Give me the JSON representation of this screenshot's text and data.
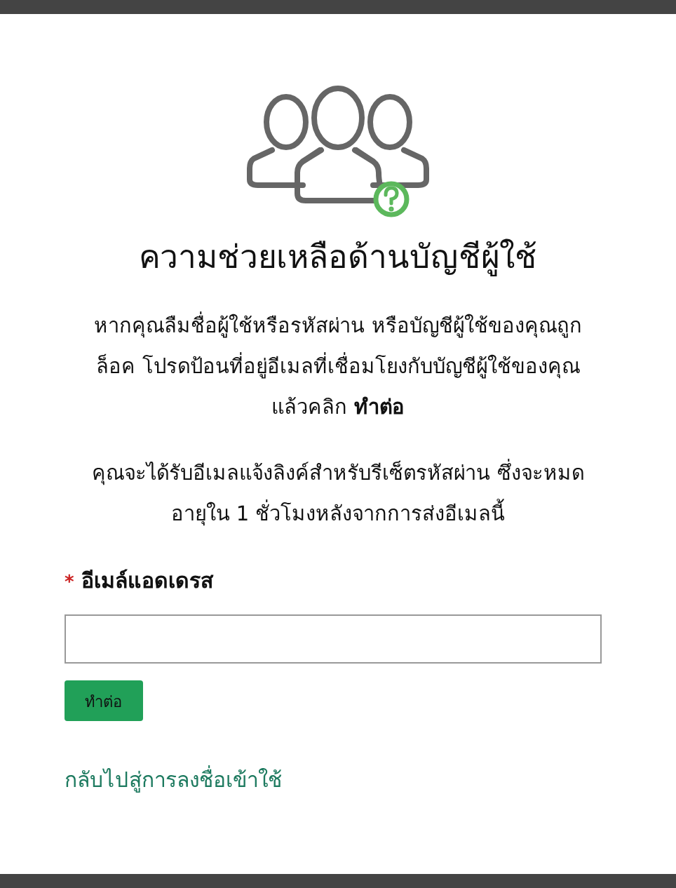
{
  "title": "ความช่วยเหลือด้านบัญชีผู้ใช้",
  "paragraphs": [
    "หากคุณลืมชื่อผู้ใช้หรือรหัสผ่าน หรือบัญชีผู้ใช้ของคุณถูกล็อค โปรดป้อนที่อยู่อีเมลที่เชื่อมโยงกับบัญชีผู้ใช้ของคุณ แล้วคลิก **ทำต่อ**",
    "คุณจะได้รับอีเมลแจ้งลิงค์สำหรับรีเซ็ตรหัสผ่าน ซึ่งจะหมดอายุใน 1 ชั่วโมงหลังจากการส่งอีเมลนี้"
  ],
  "email_field": {
    "required_mark": "*",
    "label": "อีเมล์แอดเดรส"
  },
  "buttons": [
    "ทำต่อ"
  ],
  "back_link": "กลับไปสู่การลงชื่อเข้าใช้"
}
